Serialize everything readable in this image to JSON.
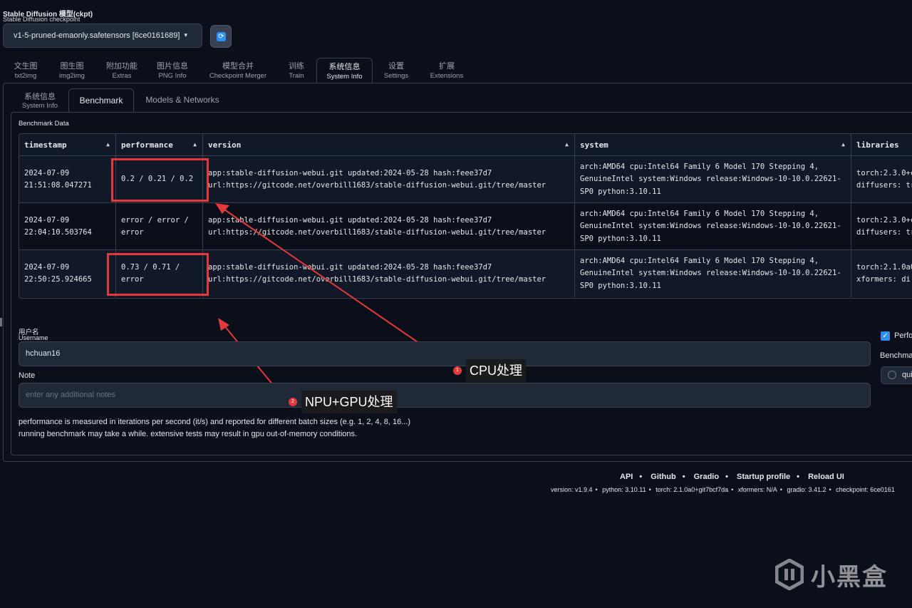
{
  "checkpoint": {
    "label_cn": "Stable Diffusion 模型(ckpt)",
    "label_en": "Stable Diffusion checkpoint",
    "value": "v1-5-pruned-emaonly.safetensors [6ce0161689]",
    "caret": "▾",
    "refresh_icon": "refresh-icon",
    "refresh_glyph": "⟳"
  },
  "main_tabs": [
    {
      "cn": "文生图",
      "en": "txt2img"
    },
    {
      "cn": "图生图",
      "en": "img2img"
    },
    {
      "cn": "附加功能",
      "en": "Extras"
    },
    {
      "cn": "图片信息",
      "en": "PNG Info"
    },
    {
      "cn": "模型合并",
      "en": "Checkpoint Merger"
    },
    {
      "cn": "训练",
      "en": "Train"
    },
    {
      "cn": "系统信息",
      "en": "System Info"
    },
    {
      "cn": "设置",
      "en": "Settings"
    },
    {
      "cn": "扩展",
      "en": "Extensions"
    }
  ],
  "sub_tabs": {
    "system_info_cn": "系统信息",
    "system_info_en": "System Info",
    "benchmark": "Benchmark",
    "models": "Models & Networks"
  },
  "benchmark_title": "Benchmark Data",
  "table": {
    "headers": [
      "timestamp",
      "performance",
      "version",
      "system",
      "libraries"
    ],
    "sort_glyph": "▲",
    "rows": [
      {
        "timestamp": [
          "2024-07-09",
          "21:51:08.047271"
        ],
        "performance": [
          "0.2 / 0.21 / 0.2"
        ],
        "version": [
          "app:stable-diffusion-webui.git updated:2024-05-28 hash:feee37d7",
          "url:https://gitcode.net/overbill1683/stable-diffusion-webui.git/tree/master"
        ],
        "system": [
          "arch:AMD64 cpu:Intel64 Family 6 Model 170 Stepping 4,",
          "GenuineIntel system:Windows release:Windows-10-10.0.22621-",
          "SP0 python:3.10.11"
        ],
        "libraries": [
          "torch:2.3.0+c",
          "diffusers: tr"
        ]
      },
      {
        "timestamp": [
          "2024-07-09",
          "22:04:10.503764"
        ],
        "performance": [
          "error / error /",
          "error"
        ],
        "version": [
          "app:stable-diffusion-webui.git updated:2024-05-28 hash:feee37d7",
          "url:https://gitcode.net/overbill1683/stable-diffusion-webui.git/tree/master"
        ],
        "system": [
          "arch:AMD64 cpu:Intel64 Family 6 Model 170 Stepping 4,",
          "GenuineIntel system:Windows release:Windows-10-10.0.22621-",
          "SP0 python:3.10.11"
        ],
        "libraries": [
          "torch:2.3.0+c",
          "diffusers: tr"
        ]
      },
      {
        "timestamp": [
          "2024-07-09",
          "22:50:25.924665"
        ],
        "performance": [
          "0.73 / 0.71 /",
          "error"
        ],
        "version": [
          "app:stable-diffusion-webui.git updated:2024-05-28 hash:feee37d7",
          "url:https://gitcode.net/overbill1683/stable-diffusion-webui.git/tree/master"
        ],
        "system": [
          "arch:AMD64 cpu:Intel64 Family 6 Model 170 Stepping 4,",
          "GenuineIntel system:Windows release:Windows-10-10.0.22621-",
          "SP0 python:3.10.11"
        ],
        "libraries": [
          "torch:2.1.0a0",
          "xformers: di"
        ]
      }
    ]
  },
  "form": {
    "username_label_cn": "用户名",
    "username_label_en": "Username",
    "username_value": "hchuan16",
    "note_label": "Note",
    "note_placeholder": "enter any additional notes",
    "desc1": "performance is measured in iterations per second (it/s) and reported for different batch sizes (e.g. 1, 2, 4, 8, 16...)",
    "desc2": "running benchmark may take a while. extensive tests may result in gpu out-of-memory conditions."
  },
  "side": {
    "checkbox_label": "Perfo",
    "checkbox_glyph": "✓",
    "bench_label": "Benchma",
    "radio_label": "qui"
  },
  "annotations": [
    {
      "num": "1",
      "text": "CPU处理"
    },
    {
      "num": "2",
      "text": "NPU+GPU处理"
    }
  ],
  "footer": {
    "links": [
      "API",
      "Github",
      "Gradio",
      "Startup profile",
      "Reload UI"
    ],
    "separator": "•",
    "versions": [
      "version: v1.9.4",
      "python: 3.10.11",
      "torch: 2.1.0a0+git7bcf7da",
      "xformers: N/A",
      "gradio: 3.41.2",
      "checkpoint: 6ce0161"
    ]
  },
  "watermark": "小黑盒",
  "colors": {
    "background": "#0b0f19",
    "panel": "#1f2937",
    "border": "#374151",
    "highlight": "#e5383b",
    "accent": "#2d8ef4"
  }
}
